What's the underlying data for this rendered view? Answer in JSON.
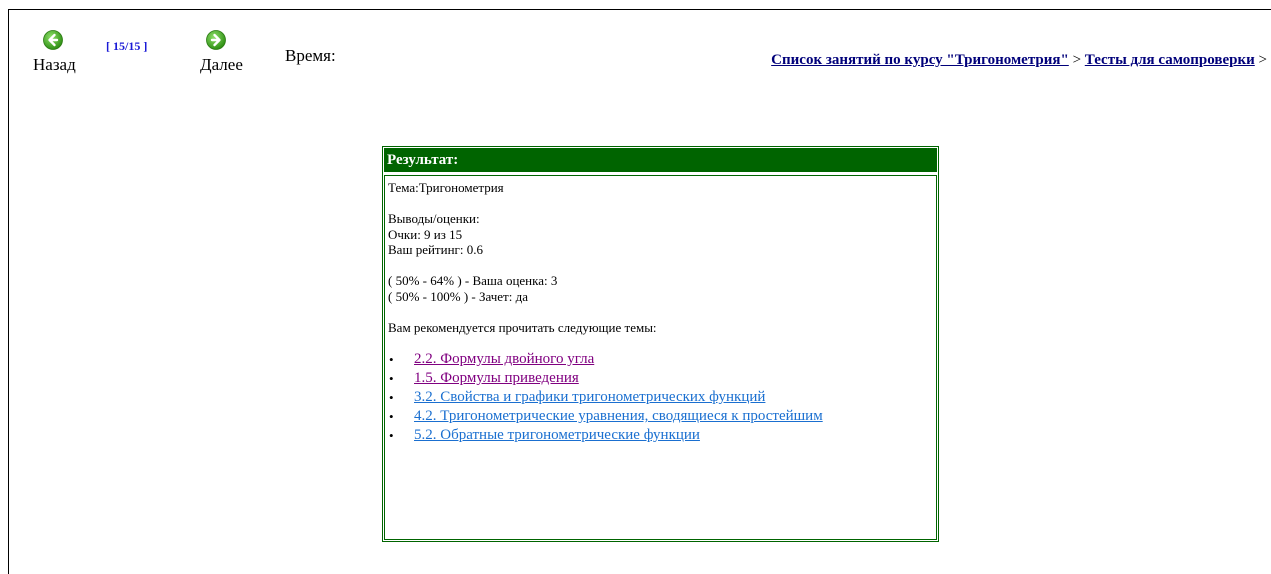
{
  "nav": {
    "back_label": "Назад",
    "next_label": "Далее",
    "counter": "[ 15/15 ]",
    "time_label": "Время:"
  },
  "breadcrumb": {
    "course_link": "Список занятий по курсу \"Тригонометрия\"",
    "separator": ">",
    "tests_link": "Тесты для самопроверки",
    "trailing": ">"
  },
  "result": {
    "header": "Результат:",
    "topic": "Тема:Тригонометрия",
    "conclusions_label": "Выводы/оценки:",
    "score": "Очки: 9 из 15",
    "rating": "Ваш рейтинг: 0.6",
    "grade_line": "( 50% - 64% ) - Ваша оценка: 3",
    "pass_line": "( 50% - 100% ) - Зачет: да",
    "recommend_label": "Вам рекомендуется прочитать следующие темы:",
    "bullet": "•",
    "recommendations": [
      {
        "label": "2.2. Формулы двойного угла",
        "visited": true
      },
      {
        "label": "1.5. Формулы приведения",
        "visited": true
      },
      {
        "label": "3.2. Свойства и графики тригонометрических функций",
        "visited": false
      },
      {
        "label": "4.2. Тригонометрические уравнения, сводящиеся к простейшим",
        "visited": false
      },
      {
        "label": "5.2. Обратные тригонометрические функции",
        "visited": false
      }
    ]
  },
  "colors": {
    "header_green": "#006400",
    "nav_icon_green": "#3aa51c",
    "breadcrumb_link": "#00007a",
    "visited_link": "#800080",
    "unvisited_link": "#1a6fd0",
    "counter_blue": "#1a1ad6"
  },
  "icons": {
    "back": "arrow-left-circle-icon",
    "next": "arrow-right-circle-icon"
  }
}
